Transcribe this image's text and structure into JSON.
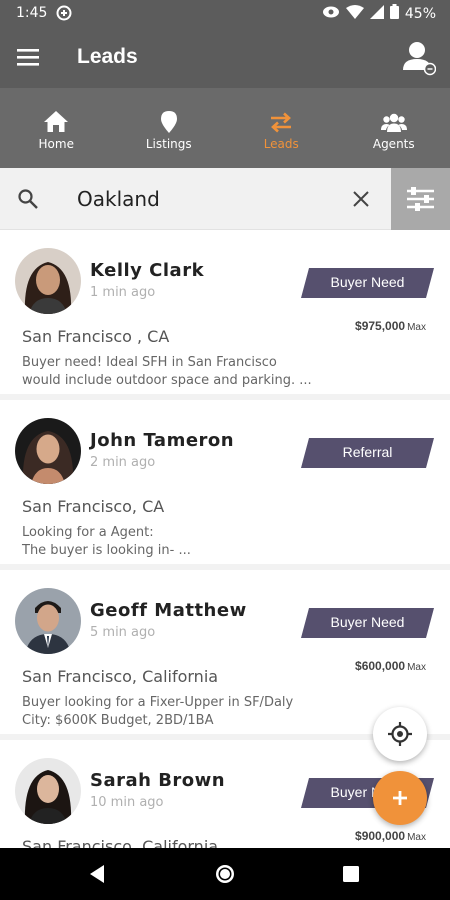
{
  "status_bar": {
    "time": "1:45",
    "battery": "45%"
  },
  "app_bar": {
    "title": "Leads"
  },
  "tabs": [
    {
      "label": "Home",
      "icon": "home-icon",
      "active": false
    },
    {
      "label": "Listings",
      "icon": "map-pin-icon",
      "active": false
    },
    {
      "label": "Leads",
      "icon": "swap-arrows-icon",
      "active": true
    },
    {
      "label": "Agents",
      "icon": "agents-group-icon",
      "active": false
    }
  ],
  "search": {
    "value": "Oakland"
  },
  "colors": {
    "accent": "#f0923a",
    "badge": "#56506e",
    "header": "#5c5c5c"
  },
  "leads": [
    {
      "name": "Kelly Clark",
      "ago": "1 min ago",
      "badge": "Buyer Need",
      "price": "$975,000",
      "price_suffix": "Max",
      "location": "San Francisco , CA",
      "description": "Buyer need! Ideal SFH in San Francisco\nwould include outdoor space and parking. ..."
    },
    {
      "name": "John Tameron",
      "ago": "2 min ago",
      "badge": "Referral",
      "price": "",
      "price_suffix": "",
      "location": "San Francisco, CA",
      "description": "Looking for a Agent:\nThe buyer is looking in- ..."
    },
    {
      "name": "Geoff Matthew",
      "ago": "5 min ago",
      "badge": "Buyer Need",
      "price": "$600,000",
      "price_suffix": "Max",
      "location": "San Francisco, California",
      "description": "Buyer looking for a Fixer-Upper in SF/Daly\nCity: $600K Budget, 2BD/1BA"
    },
    {
      "name": "Sarah Brown",
      "ago": "10 min ago",
      "badge": "Buyer Need",
      "price": "$900,000",
      "price_suffix": "Max",
      "location": "San Francisco, California",
      "description": ""
    }
  ]
}
